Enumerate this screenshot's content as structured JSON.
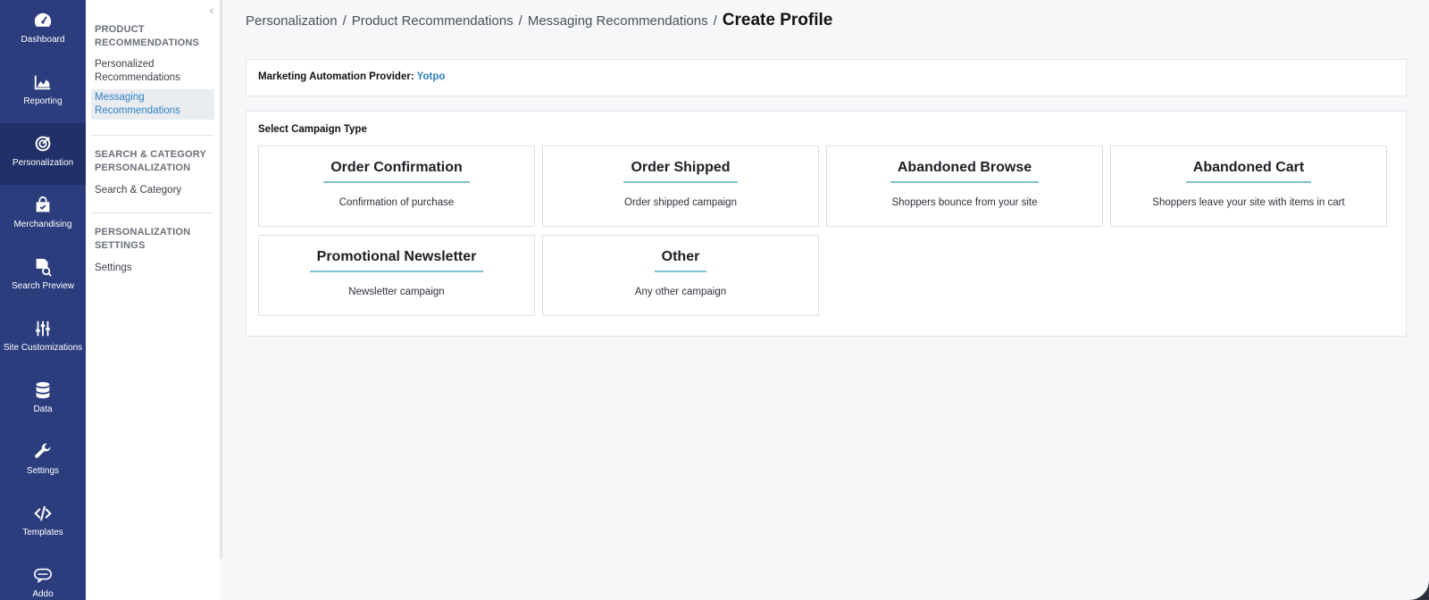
{
  "rail": {
    "items": [
      {
        "label": "Dashboard",
        "icon": "gauge-icon"
      },
      {
        "label": "Reporting",
        "icon": "area-chart-icon"
      },
      {
        "label": "Personalization",
        "icon": "target-icon"
      },
      {
        "label": "Merchandising",
        "icon": "shopping-bag-icon"
      },
      {
        "label": "Search Preview",
        "icon": "document-search-icon"
      },
      {
        "label": "Site Customizations",
        "icon": "sliders-icon"
      },
      {
        "label": "Data",
        "icon": "database-icon"
      },
      {
        "label": "Settings",
        "icon": "wrench-icon"
      },
      {
        "label": "Templates",
        "icon": "code-icon"
      },
      {
        "label": "Addo",
        "icon": "chat-icon"
      }
    ],
    "active": "Personalization"
  },
  "subnav": {
    "sections": [
      {
        "title": "PRODUCT RECOMMENDATIONS",
        "links": [
          "Personalized Recommendations",
          "Messaging Recommendations"
        ]
      },
      {
        "title": "SEARCH & CATEGORY PERSONALIZATION",
        "links": [
          "Search & Category"
        ]
      },
      {
        "title": "PERSONALIZATION SETTINGS",
        "links": [
          "Settings"
        ]
      }
    ],
    "active_link": "Messaging Recommendations",
    "collapse_icon": "chevron-left-icon"
  },
  "breadcrumb": {
    "items": [
      "Personalization",
      "Product Recommendations",
      "Messaging Recommendations"
    ],
    "separator": "/",
    "current": "Create Profile"
  },
  "provider": {
    "label": "Marketing Automation Provider:",
    "value": "Yotpo"
  },
  "campaigns": {
    "title": "Select Campaign Type",
    "cards": [
      {
        "title": "Order Confirmation",
        "desc": "Confirmation of purchase"
      },
      {
        "title": "Order Shipped",
        "desc": "Order shipped campaign"
      },
      {
        "title": "Abandoned Browse",
        "desc": "Shoppers bounce from your site"
      },
      {
        "title": "Abandoned Cart",
        "desc": "Shoppers leave your site with items in cart"
      },
      {
        "title": "Promotional Newsletter",
        "desc": "Newsletter campaign"
      },
      {
        "title": "Other",
        "desc": "Any other campaign"
      }
    ]
  },
  "colors": {
    "rail": "#2c3d7e",
    "rail_active": "#22306a",
    "link": "#2f7fc1",
    "card_underline": "#7fbfd4"
  }
}
